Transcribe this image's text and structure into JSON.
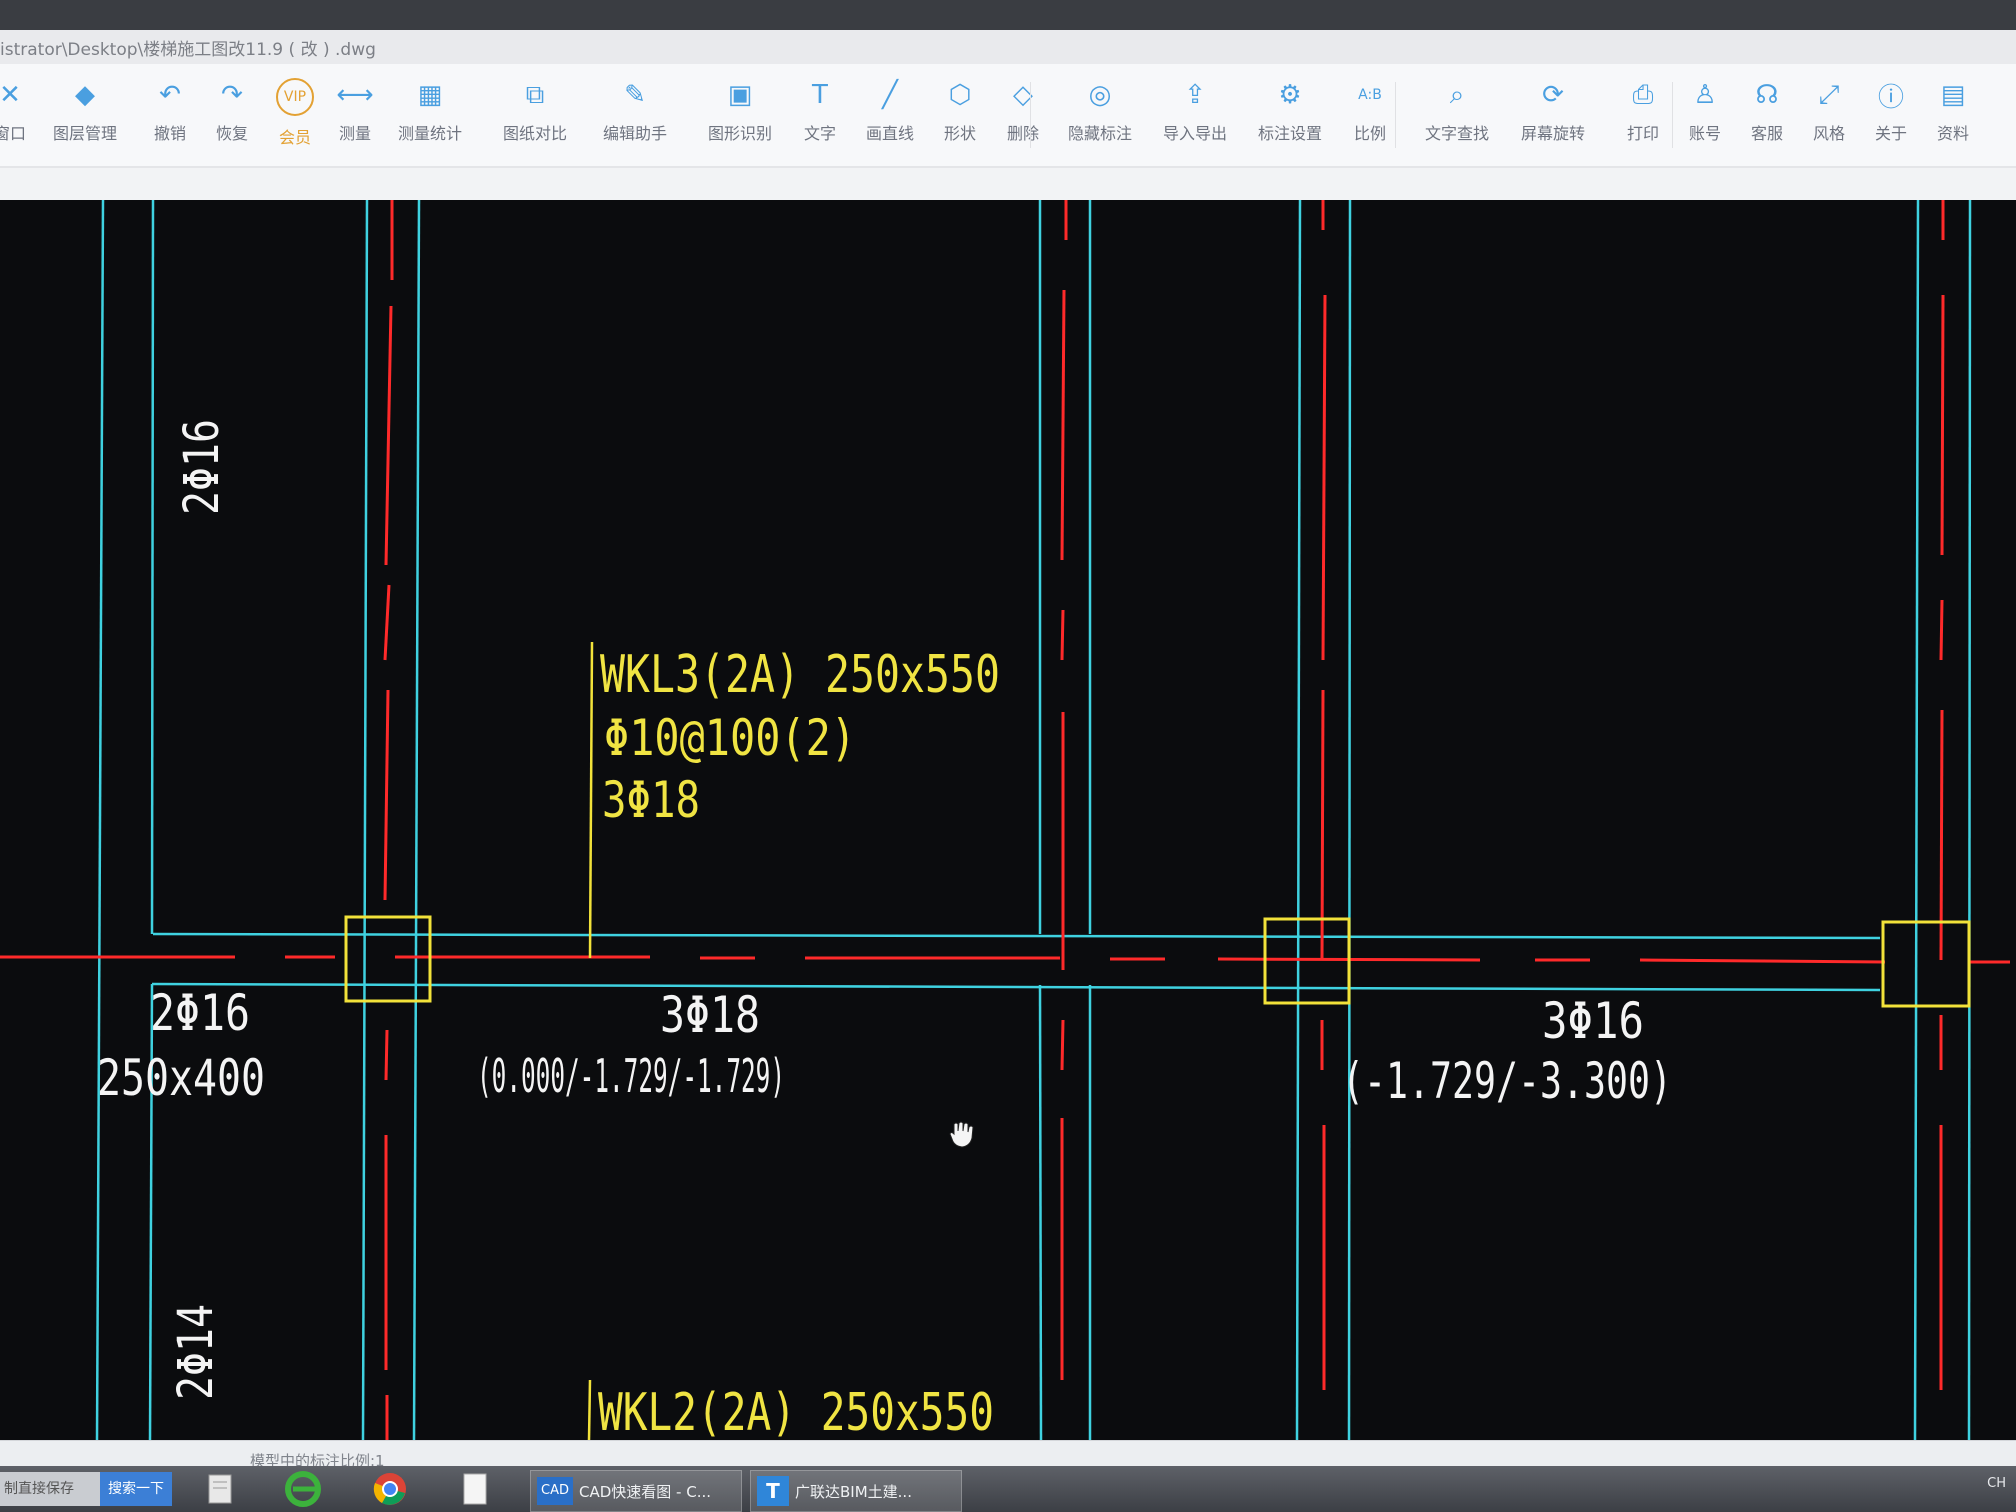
{
  "window": {
    "title": "istrator\\Desktop\\楼梯施工图改11.9 ( 改 ) .dwg"
  },
  "toolbar": {
    "items": [
      {
        "label": "窗口",
        "icon": "window-icon"
      },
      {
        "label": "图层管理",
        "icon": "layers-icon"
      },
      {
        "label": "撤销",
        "icon": "undo-icon"
      },
      {
        "label": "恢复",
        "icon": "redo-icon"
      },
      {
        "label": "会员",
        "icon": "vip-icon"
      },
      {
        "label": "测量",
        "icon": "measure-icon"
      },
      {
        "label": "测量统计",
        "icon": "measure-stats-icon"
      },
      {
        "label": "图纸对比",
        "icon": "compare-icon"
      },
      {
        "label": "编辑助手",
        "icon": "edit-assistant-icon"
      },
      {
        "label": "图形识别",
        "icon": "shape-recognition-icon"
      },
      {
        "label": "文字",
        "icon": "text-icon"
      },
      {
        "label": "画直线",
        "icon": "line-icon"
      },
      {
        "label": "形状",
        "icon": "shape-icon"
      },
      {
        "label": "删除",
        "icon": "eraser-icon"
      },
      {
        "label": "隐藏标注",
        "icon": "hide-annotation-icon"
      },
      {
        "label": "导入导出",
        "icon": "import-export-icon"
      },
      {
        "label": "标注设置",
        "icon": "annotation-settings-icon"
      },
      {
        "label": "比例",
        "icon": "scale-icon"
      },
      {
        "label": "文字查找",
        "icon": "text-search-icon"
      },
      {
        "label": "屏幕旋转",
        "icon": "screen-rotate-icon"
      },
      {
        "label": "打印",
        "icon": "print-icon"
      },
      {
        "label": "账号",
        "icon": "account-icon"
      },
      {
        "label": "客服",
        "icon": "headset-icon"
      },
      {
        "label": "风格",
        "icon": "style-icon"
      },
      {
        "label": "关于",
        "icon": "info-icon"
      },
      {
        "label": "资料",
        "icon": "resources-icon"
      }
    ]
  },
  "drawing": {
    "colors": {
      "background": "#0b0c0e",
      "wall": "#3fd2e0",
      "axis": "#ff2a2a",
      "column": "#f2e23a",
      "annotation": "#f0e443",
      "text": "#f4f4f4"
    },
    "beam_label_1": {
      "name": "WKL3(2A) 250x550",
      "stirrup": "Φ10@100(2)",
      "top_bars": "3Φ18"
    },
    "beam_label_2": {
      "name": "WKL2(2A) 250x550"
    },
    "left_vertical_top": "2Φ16",
    "left_vertical_bottom": "2Φ14",
    "left_bars": "2Φ16",
    "left_size": "250x400",
    "mid_bars": "3Φ18",
    "mid_elev": "(0.000/-1.729/-1.729)",
    "right_bars": "3Φ16",
    "right_elev": "(-1.729/-3.300)"
  },
  "status": {
    "text": "模型中的标注比例:1"
  },
  "taskbar": {
    "search_text": "制直接保存",
    "search_button": "搜索一下",
    "apps": [
      {
        "label": "CAD快速看图 - C...",
        "icon": "cad-app-icon"
      },
      {
        "label": "广联达BIM土建...",
        "icon": "glodon-app-icon"
      }
    ],
    "tray_text": "CH"
  }
}
